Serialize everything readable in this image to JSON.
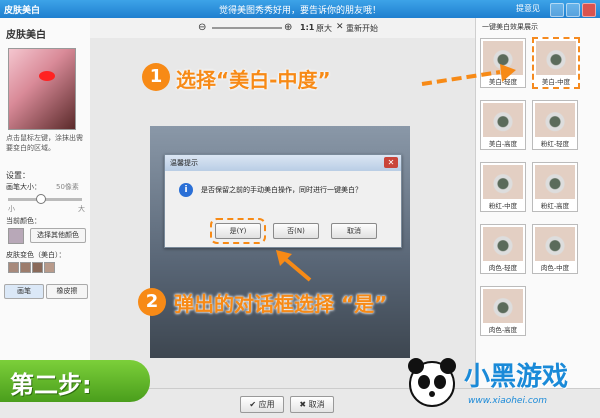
{
  "titlebar": {
    "app": "皮肤美白",
    "banner": "觉得美图秀秀好用，要告诉你的朋友哦！",
    "feedback": "提意见"
  },
  "left_panel": {
    "title": "皮肤美白",
    "hint": "点击鼠标左键，涂抹出需要变白的区域。",
    "settings_label": "设置：",
    "brush_size_label": "画笔大小：",
    "brush_size_value": "50像素",
    "small_label": "小",
    "large_label": "大",
    "current_color_label": "当前颜色：",
    "choose_color_button": "选择其他颜色",
    "skin_color_label": "皮肤变色（美白）：",
    "swatches": [
      "#a88a7c",
      "#9c7c6c",
      "#8a6a5a",
      "#b89a8a"
    ],
    "tool_brush": "画笔",
    "tool_eraser": "橡皮擦"
  },
  "toolbar": {
    "zoom_ratio": "1:1",
    "original_size": "原大",
    "reset": "重新开始"
  },
  "dialog": {
    "title": "温馨提示",
    "message": "是否保留之前的手动美白操作，同时进行一键美白？",
    "yes": "是(Y)",
    "no": "否(N)",
    "cancel": "取消"
  },
  "right_panel": {
    "title": "一键美白效果展示",
    "effects": [
      "美白-轻度",
      "美白-中度",
      "美白-高度",
      "粉红-轻度",
      "粉红-中度",
      "粉红-高度",
      "肉色-轻度",
      "肉色-中度",
      "肉色-高度"
    ]
  },
  "annotations": {
    "step1_num": "1",
    "step1": "选择“美白-中度”",
    "step2_num": "2",
    "step2": "弹出的对话框选择 “是”",
    "step_banner": "第二步:"
  },
  "bottom": {
    "apply": "应用",
    "cancel": "取消"
  },
  "logo": {
    "name": "小黑游戏",
    "url": "www.xiaohei.com"
  },
  "colors": {
    "accent": "#f78a16",
    "title_blue": "#2a8fe0",
    "step_green": "#5bb02a"
  }
}
